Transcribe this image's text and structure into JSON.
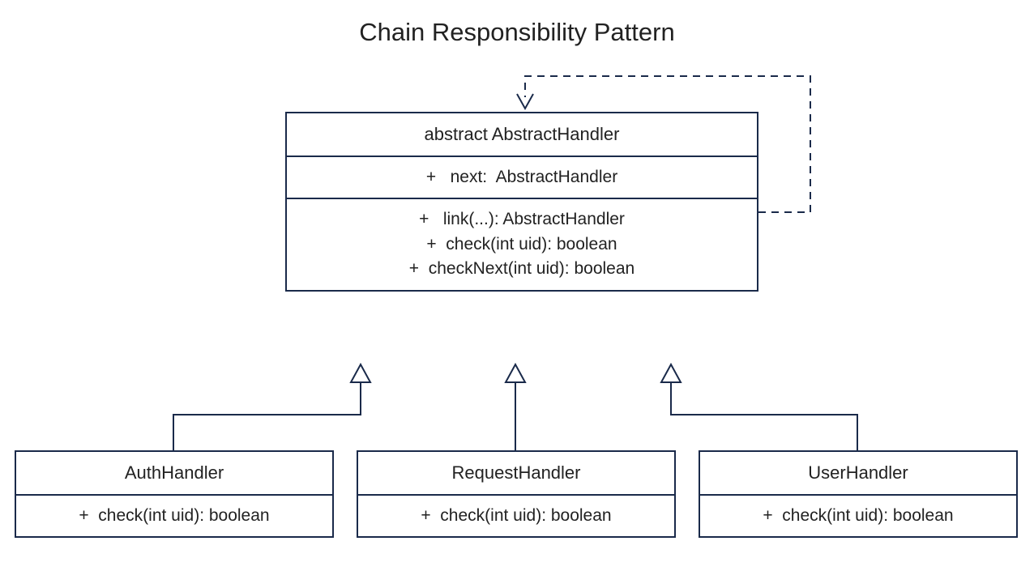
{
  "title": "Chain Responsibility Pattern",
  "abstract_class": {
    "name": "abstract AbstractHandler",
    "attributes": [
      "+   next:  AbstractHandler"
    ],
    "methods": [
      "+   link(...): AbstractHandler",
      "+  check(int uid): boolean",
      "+  checkNext(int uid): boolean"
    ]
  },
  "subclasses": [
    {
      "name": "AuthHandler",
      "methods": [
        "+  check(int uid): boolean"
      ]
    },
    {
      "name": "RequestHandler",
      "methods": [
        "+  check(int uid): boolean"
      ]
    },
    {
      "name": "UserHandler",
      "methods": [
        "+  check(int uid): boolean"
      ]
    }
  ]
}
